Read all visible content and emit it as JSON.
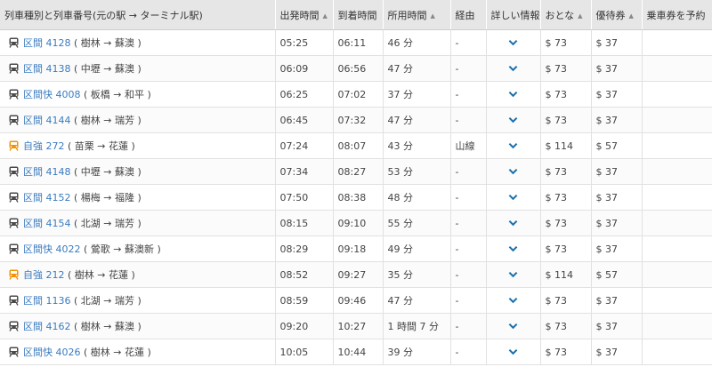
{
  "colors": {
    "local": "#4a4a4a",
    "express": "#f29200",
    "link": "#3a7bbf",
    "chevron": "#1a6fad"
  },
  "headers": [
    {
      "label": "列車種別と列車番号(元の駅 → ターミナル駅)",
      "sortable": false
    },
    {
      "label": "出発時間",
      "sortable": true
    },
    {
      "label": "到着時間",
      "sortable": false
    },
    {
      "label": "所用時間",
      "sortable": true
    },
    {
      "label": "経由",
      "sortable": false
    },
    {
      "label": "詳しい情報",
      "sortable": false
    },
    {
      "label": "おとな",
      "sortable": true
    },
    {
      "label": "優待券",
      "sortable": true
    },
    {
      "label": "乗車券を予約",
      "sortable": false
    }
  ],
  "rows": [
    {
      "type": "local",
      "train": "区間 4128",
      "route": "( 樹林 → 蘇澳 )",
      "dep": "05:25",
      "arr": "06:11",
      "dur": "46 分",
      "via": "-",
      "adult": "$ 73",
      "concession": "$ 37",
      "reserve": ""
    },
    {
      "type": "local",
      "train": "区間 4138",
      "route": "( 中壢 → 蘇澳 )",
      "dep": "06:09",
      "arr": "06:56",
      "dur": "47 分",
      "via": "-",
      "adult": "$ 73",
      "concession": "$ 37",
      "reserve": ""
    },
    {
      "type": "local",
      "train": "区間快 4008",
      "route": "( 板橋 → 和平 )",
      "dep": "06:25",
      "arr": "07:02",
      "dur": "37 分",
      "via": "-",
      "adult": "$ 73",
      "concession": "$ 37",
      "reserve": ""
    },
    {
      "type": "local",
      "train": "区間 4144",
      "route": "( 樹林 → 瑞芳 )",
      "dep": "06:45",
      "arr": "07:32",
      "dur": "47 分",
      "via": "-",
      "adult": "$ 73",
      "concession": "$ 37",
      "reserve": ""
    },
    {
      "type": "express",
      "train": "自強 272",
      "route": "( 苗栗 → 花蓮 )",
      "dep": "07:24",
      "arr": "08:07",
      "dur": "43 分",
      "via": "山線",
      "adult": "$ 114",
      "concession": "$ 57",
      "reserve": ""
    },
    {
      "type": "local",
      "train": "区間 4148",
      "route": "( 中壢 → 蘇澳 )",
      "dep": "07:34",
      "arr": "08:27",
      "dur": "53 分",
      "via": "-",
      "adult": "$ 73",
      "concession": "$ 37",
      "reserve": ""
    },
    {
      "type": "local",
      "train": "区間 4152",
      "route": "( 楊梅 → 福隆 )",
      "dep": "07:50",
      "arr": "08:38",
      "dur": "48 分",
      "via": "-",
      "adult": "$ 73",
      "concession": "$ 37",
      "reserve": ""
    },
    {
      "type": "local",
      "train": "区間 4154",
      "route": "( 北湖 → 瑞芳 )",
      "dep": "08:15",
      "arr": "09:10",
      "dur": "55 分",
      "via": "-",
      "adult": "$ 73",
      "concession": "$ 37",
      "reserve": ""
    },
    {
      "type": "local",
      "train": "区間快 4022",
      "route": "( 鶯歌 → 蘇澳新 )",
      "dep": "08:29",
      "arr": "09:18",
      "dur": "49 分",
      "via": "-",
      "adult": "$ 73",
      "concession": "$ 37",
      "reserve": ""
    },
    {
      "type": "express",
      "train": "自強 212",
      "route": "( 樹林 → 花蓮 )",
      "dep": "08:52",
      "arr": "09:27",
      "dur": "35 分",
      "via": "-",
      "adult": "$ 114",
      "concession": "$ 57",
      "reserve": ""
    },
    {
      "type": "local",
      "train": "区間 1136",
      "route": "( 北湖 → 瑞芳 )",
      "dep": "08:59",
      "arr": "09:46",
      "dur": "47 分",
      "via": "-",
      "adult": "$ 73",
      "concession": "$ 37",
      "reserve": ""
    },
    {
      "type": "local",
      "train": "区間 4162",
      "route": "( 樹林 → 蘇澳 )",
      "dep": "09:20",
      "arr": "10:27",
      "dur": "1 時間 7 分",
      "via": "-",
      "adult": "$ 73",
      "concession": "$ 37",
      "reserve": ""
    },
    {
      "type": "local",
      "train": "区間快 4026",
      "route": "( 樹林 → 花蓮 )",
      "dep": "10:05",
      "arr": "10:44",
      "dur": "39 分",
      "via": "-",
      "adult": "$ 73",
      "concession": "$ 37",
      "reserve": ""
    }
  ]
}
